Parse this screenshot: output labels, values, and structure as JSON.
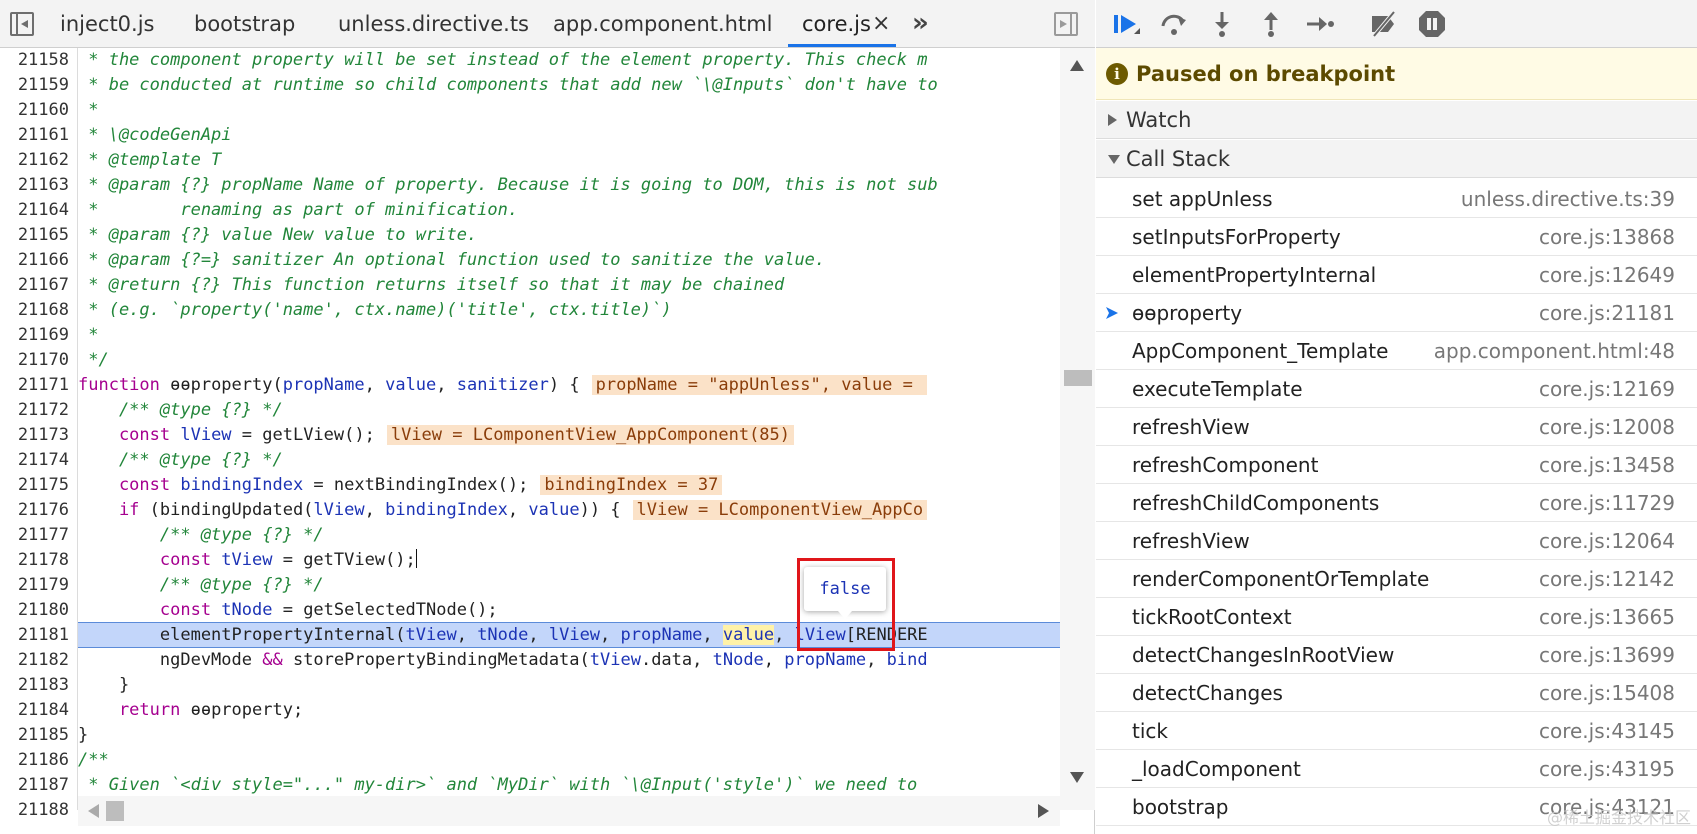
{
  "editor": {
    "tabs": [
      {
        "label": "inject0.js"
      },
      {
        "label": "bootstrap"
      },
      {
        "label": "unless.directive.ts"
      },
      {
        "label": "app.component.html"
      },
      {
        "label": "core.js",
        "active": true
      }
    ],
    "close_glyph": "×",
    "more_glyph": "»",
    "line_numbers": [
      "21158",
      "21159",
      "21160",
      "21161",
      "21162",
      "21163",
      "21164",
      "21165",
      "21166",
      "21167",
      "21168",
      "21169",
      "21170",
      "21171",
      "21172",
      "21173",
      "21174",
      "21175",
      "21176",
      "21177",
      "21178",
      "21179",
      "21180",
      "21181",
      "21182",
      "21183",
      "21184",
      "21185",
      "21186",
      "21187",
      "21188"
    ],
    "current_line": "21181",
    "lines": {
      "l21158": " * the component property will be set instead of the element property. This check m",
      "l21159": " * be conducted at runtime so child components that add new `\\@Inputs` don't have to",
      "l21160": " *",
      "l21161": " * \\@codeGenApi",
      "l21162": " * @template T",
      "l21163": " * @param {?} propName Name of property. Because it is going to DOM, this is not sub",
      "l21164": " *        renaming as part of minification.",
      "l21165": " * @param {?} value New value to write.",
      "l21166": " * @param {?=} sanitizer An optional function used to sanitize the value.",
      "l21167": " * @return {?} This function returns itself so that it may be chained",
      "l21168": " * (e.g. `property('name', ctx.name)('title', ctx.title)`)",
      "l21169": " *",
      "l21170": " */",
      "l21171_kw": "function ",
      "l21171_fn": "ɵɵproperty(",
      "l21171_p1": "propName",
      "l21171_s1": ", ",
      "l21171_p2": "value",
      "l21171_s2": ", ",
      "l21171_p3": "sanitizer",
      "l21171_s3": ") {",
      "l21171_val": "propName = \"appUnless\", value = ",
      "l21172": "    /** @type {?} */",
      "l21173_kw": "    const ",
      "l21173_var": "lView",
      "l21173_rest": " = getLView();",
      "l21173_val": "lView = LComponentView_AppComponent(85)",
      "l21174": "    /** @type {?} */",
      "l21175_kw": "    const ",
      "l21175_var": "bindingIndex",
      "l21175_rest": " = nextBindingIndex();",
      "l21175_val": "bindingIndex = 37",
      "l21176_kw": "    if ",
      "l21176_a": "(bindingUpdated(",
      "l21176_v1": "lView",
      "l21176_b": ", ",
      "l21176_v2": "bindingIndex",
      "l21176_c": ", ",
      "l21176_v3": "value",
      "l21176_d": ")) {",
      "l21176_val": "lView = LComponentView_AppCo",
      "l21177": "        /** @type {?} */",
      "l21178_kw": "        const ",
      "l21178_var": "tView",
      "l21178_rest": " = getTView();",
      "l21179": "        /** @type {?} */",
      "l21180_kw": "        const ",
      "l21180_var": "tNode",
      "l21180_rest": " = getSelectedTNode();",
      "l21181_a": "        elementPropertyInternal(",
      "l21181_v1": "tView",
      "l21181_b": ", ",
      "l21181_v2": "tNode",
      "l21181_c": ", ",
      "l21181_v3": "lView",
      "l21181_d": ", ",
      "l21181_v4": "propName",
      "l21181_e": ", ",
      "l21181_v5": "value",
      "l21181_f": ", ",
      "l21181_v6": "lView",
      "l21181_g": "[RENDERE",
      "l21182_a": "        ngDevMode ",
      "l21182_op": "&&",
      "l21182_b": " storePropertyBindingMetadata(",
      "l21182_v1": "tView",
      "l21182_c": ".data, ",
      "l21182_v2": "tNode",
      "l21182_d": ", ",
      "l21182_v3": "propName",
      "l21182_e": ", ",
      "l21182_v4": "bind",
      "l21183": "    }",
      "l21184_kw": "    return ",
      "l21184_rest": "ɵɵproperty;",
      "l21185": "}",
      "l21186": "/**",
      "l21187": " * Given `<div style=\"...\" my-dir>` and `MyDir` with `\\@Input('style')` we need to",
      "l21188": ""
    },
    "hover_popover_value": "false"
  },
  "debugger": {
    "toolbar_icons": [
      "resume-icon",
      "step-over-icon",
      "step-into-icon",
      "step-out-icon",
      "step-icon",
      "deactivate-breakpoints-icon",
      "pause-on-exceptions-icon"
    ],
    "paused_message": "Paused on breakpoint",
    "watch_label": "Watch",
    "call_stack_label": "Call Stack",
    "call_stack": [
      {
        "name": "set appUnless",
        "location": "unless.directive.ts:39"
      },
      {
        "name": "setInputsForProperty",
        "location": "core.js:13868"
      },
      {
        "name": "elementPropertyInternal",
        "location": "core.js:12649"
      },
      {
        "name": "ɵɵproperty",
        "location": "core.js:21181",
        "current": true
      },
      {
        "name": "AppComponent_Template",
        "location": "app.component.html:48"
      },
      {
        "name": "executeTemplate",
        "location": "core.js:12169"
      },
      {
        "name": "refreshView",
        "location": "core.js:12008"
      },
      {
        "name": "refreshComponent",
        "location": "core.js:13458"
      },
      {
        "name": "refreshChildComponents",
        "location": "core.js:11729"
      },
      {
        "name": "refreshView",
        "location": "core.js:12064"
      },
      {
        "name": "renderComponentOrTemplate",
        "location": "core.js:12142"
      },
      {
        "name": "tickRootContext",
        "location": "core.js:13665"
      },
      {
        "name": "detectChangesInRootView",
        "location": "core.js:13699"
      },
      {
        "name": "detectChanges",
        "location": "core.js:15408"
      },
      {
        "name": "tick",
        "location": "core.js:43145"
      },
      {
        "name": "_loadComponent",
        "location": "core.js:43195"
      },
      {
        "name": "bootstrap",
        "location": "core.js:43121"
      }
    ],
    "watermark": "@稀土掘金技术社区"
  },
  "colors": {
    "accent": "#1a73e8",
    "current_line": "#c3d6fa",
    "inline_value_bg": "#fbe2c8",
    "comment": "#22863a",
    "keyword": "#a5008f",
    "variable": "#1c33b5",
    "annotation_red": "#e0161a"
  }
}
